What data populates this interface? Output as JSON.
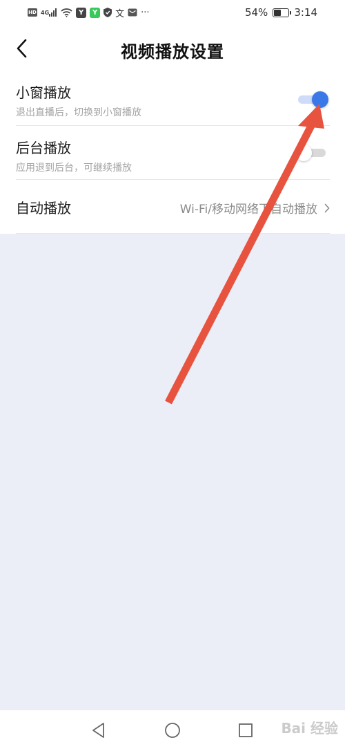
{
  "status_bar": {
    "left_icons": [
      "hd-icon",
      "4g-signal-icon",
      "wifi-icon",
      "app-notification-icon",
      "app-notification-icon",
      "shield-icon",
      "text-icon",
      "mail-icon",
      "more-icon"
    ],
    "hd": "HD",
    "network": "4G",
    "battery_percent": "54%",
    "battery_level": 0.54,
    "time": "3:14"
  },
  "header": {
    "title": "视频播放设置",
    "back_icon": "chevron-left-icon"
  },
  "settings": {
    "mini_window": {
      "title": "小窗播放",
      "subtitle": "退出直播后，切换到小窗播放",
      "enabled": true
    },
    "background": {
      "title": "后台播放",
      "subtitle": "应用退到后台，可继续播放",
      "enabled": false
    },
    "autoplay": {
      "title": "自动播放",
      "value": "Wi-Fi/移动网络下自动播放"
    }
  },
  "colors": {
    "accent": "#3b78e7",
    "arrow": "#e8533f",
    "background": "#eceef7"
  },
  "nav_bar": {
    "icons": [
      "back-triangle-icon",
      "home-circle-icon",
      "recents-square-icon"
    ]
  },
  "watermark": "Bai 经验"
}
